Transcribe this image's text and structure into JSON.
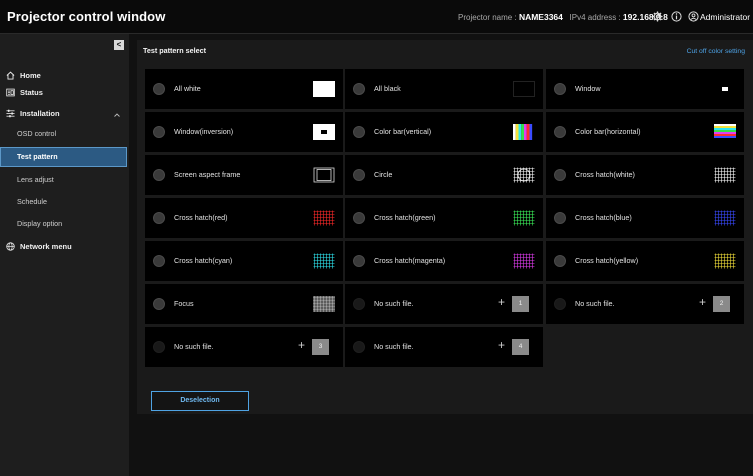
{
  "header": {
    "title": "Projector control window",
    "projector_name_label": "Projector name :",
    "projector_name": "NAME3364",
    "ipv4_label": "IPv4 address :",
    "ipv4": "192.168.0.8",
    "user": "Administrator",
    "icons": [
      "gear-icon",
      "info-icon",
      "user-icon"
    ]
  },
  "sidebar": {
    "collapse": "<",
    "home": "Home",
    "status": "Status",
    "installation": "Installation",
    "installation_items": [
      "OSD control",
      "Test pattern",
      "Lens adjust",
      "Schedule",
      "Display option"
    ],
    "active_item": "Test pattern",
    "network": "Network menu"
  },
  "main": {
    "title": "Test pattern select",
    "cutoff_link": "Cut off color setting",
    "tiles": [
      {
        "label": "All white",
        "thumb": "white"
      },
      {
        "label": "All black",
        "thumb": "black"
      },
      {
        "label": "Window",
        "thumb": "window"
      },
      {
        "label": "Window(inversion)",
        "thumb": "window-inv"
      },
      {
        "label": "Color bar(vertical)",
        "thumb": "colorbar-v"
      },
      {
        "label": "Color bar(horizontal)",
        "thumb": "colorbar-h"
      },
      {
        "label": "Screen aspect frame",
        "thumb": "aspect"
      },
      {
        "label": "Circle",
        "thumb": "circle"
      },
      {
        "label": "Cross hatch(white)",
        "thumb": "hatch-white"
      },
      {
        "label": "Cross hatch(red)",
        "thumb": "hatch-red"
      },
      {
        "label": "Cross hatch(green)",
        "thumb": "hatch-green"
      },
      {
        "label": "Cross hatch(blue)",
        "thumb": "hatch-blue"
      },
      {
        "label": "Cross hatch(cyan)",
        "thumb": "hatch-cyan"
      },
      {
        "label": "Cross hatch(magenta)",
        "thumb": "hatch-magenta"
      },
      {
        "label": "Cross hatch(yellow)",
        "thumb": "hatch-yellow"
      },
      {
        "label": "Focus",
        "thumb": "focus"
      },
      {
        "label": "No such file.",
        "plus": "+",
        "slot": "1"
      },
      {
        "label": "No such file.",
        "plus": "+",
        "slot": "2"
      },
      {
        "label": "No such file.",
        "plus": "+",
        "slot": "3"
      },
      {
        "label": "No such file.",
        "plus": "+",
        "slot": "4"
      }
    ],
    "deselect": "Deselection"
  },
  "colors": {
    "accent": "#4ea3e6",
    "active_bg": "#2c5a83",
    "hatch_white": "#ffffff",
    "hatch_red": "#ff2b2b",
    "hatch_green": "#3df05a",
    "hatch_blue": "#3a4bff",
    "hatch_cyan": "#2fe6f0",
    "hatch_magenta": "#e23cf0",
    "hatch_yellow": "#f5e23a"
  }
}
